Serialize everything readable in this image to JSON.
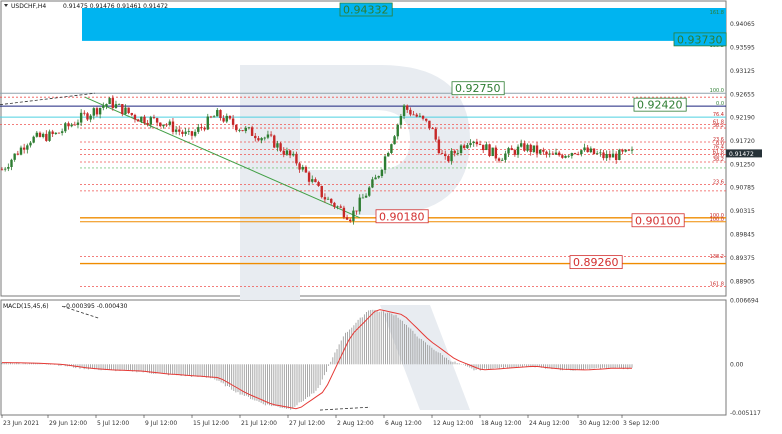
{
  "header": {
    "symbol_timeframe": "USDCHF,H4",
    "ohlc_values": "0.91475 0.91476 0.91461 0.91472"
  },
  "macd": {
    "label": "MACD(15,45,6)",
    "values": "-0.000395 -0.000430"
  },
  "colors": {
    "bull_candle": "#2e7d32",
    "bear_candle": "#c62828",
    "macd_hist": "#9e9e9e",
    "signal": "#e53935",
    "cyan_zone": "#00b4f0",
    "green_label": "#2e7d32",
    "red_label": "#d32f2f",
    "orange_level": "#ef8c00",
    "navy_level": "#1a237e",
    "last_price_bg": "#263238"
  },
  "chart_data": {
    "type": "candlestick",
    "price_axis": {
      "ylim": [
        0.8861,
        0.9439
      ],
      "ticks": [
        "0.94065",
        "0.93595",
        "0.93125",
        "0.92655",
        "0.92190",
        "0.91720",
        "0.91250",
        "0.90785",
        "0.90315",
        "0.89845",
        "0.89375",
        "0.88905"
      ]
    },
    "time_axis": {
      "labels": [
        "23 Jun 2021",
        "29 Jun 12:00",
        "5 Jul 12:00",
        "9 Jul 12:00",
        "15 Jul 12:00",
        "21 Jul 12:00",
        "27 Jul 12:00",
        "2 Aug 12:00",
        "6 Aug 12:00",
        "12 Aug 12:00",
        "18 Aug 12:00",
        "24 Aug 12:00",
        "30 Aug 12:00",
        "3 Sep 12:00"
      ]
    },
    "last_price": "0.91472",
    "trend_points": [
      {
        "t": 0,
        "p": 0.9115
      },
      {
        "t": 0.04,
        "p": 0.9175
      },
      {
        "t": 0.08,
        "p": 0.9185
      },
      {
        "t": 0.12,
        "p": 0.922
      },
      {
        "t": 0.16,
        "p": 0.925
      },
      {
        "t": 0.2,
        "p": 0.922
      },
      {
        "t": 0.24,
        "p": 0.921
      },
      {
        "t": 0.28,
        "p": 0.918
      },
      {
        "t": 0.32,
        "p": 0.9225
      },
      {
        "t": 0.36,
        "p": 0.9195
      },
      {
        "t": 0.4,
        "p": 0.9175
      },
      {
        "t": 0.44,
        "p": 0.913
      },
      {
        "t": 0.48,
        "p": 0.906
      },
      {
        "t": 0.52,
        "p": 0.902
      },
      {
        "t": 0.56,
        "p": 0.91
      },
      {
        "t": 0.6,
        "p": 0.924
      },
      {
        "t": 0.64,
        "p": 0.92
      },
      {
        "t": 0.66,
        "p": 0.913
      },
      {
        "t": 0.7,
        "p": 0.918
      },
      {
        "t": 0.74,
        "p": 0.914
      },
      {
        "t": 0.78,
        "p": 0.916
      },
      {
        "t": 0.82,
        "p": 0.914
      },
      {
        "t": 0.86,
        "p": 0.9155
      },
      {
        "t": 0.9,
        "p": 0.914
      },
      {
        "t": 0.94,
        "p": 0.9147
      }
    ],
    "macd_points": [
      0.00018,
      0.00012,
      0.0,
      -0.0004,
      -0.0006,
      -0.0007,
      -0.001,
      -0.0012,
      -0.0014,
      -0.003,
      -0.0042,
      -0.0047,
      -0.0028,
      0.003,
      0.0058,
      0.0052,
      0.0025,
      0.0005,
      -0.0006,
      -0.0004,
      -0.0002,
      -0.0005,
      -0.0006,
      -0.0004,
      -0.00043
    ],
    "macd_axis": {
      "ylim": [
        -0.00532,
        0.00675
      ],
      "ticks": [
        "0.006694",
        "0.00",
        "-0.005117"
      ]
    },
    "fib_levels_top": [
      "161.8",
      "138.2"
    ],
    "fib_levels_mid": [
      "100.0",
      "0.0",
      "76.4",
      "61.8",
      "38.2",
      "23.6",
      "0.0",
      "76.4",
      "61.8",
      "50.0",
      "38.2",
      "23.6",
      "100.0"
    ],
    "fib_levels_bottom": [
      "100.0",
      "138.2",
      "161.8"
    ],
    "labels": {
      "top_target": "0.94332",
      "cyan_target_2": "0.93730",
      "upper_resistance": "0.92750",
      "mid_resistance": "0.92420",
      "support_low": "0.90180",
      "support_2": "0.90100",
      "support_3": "0.89260"
    }
  }
}
